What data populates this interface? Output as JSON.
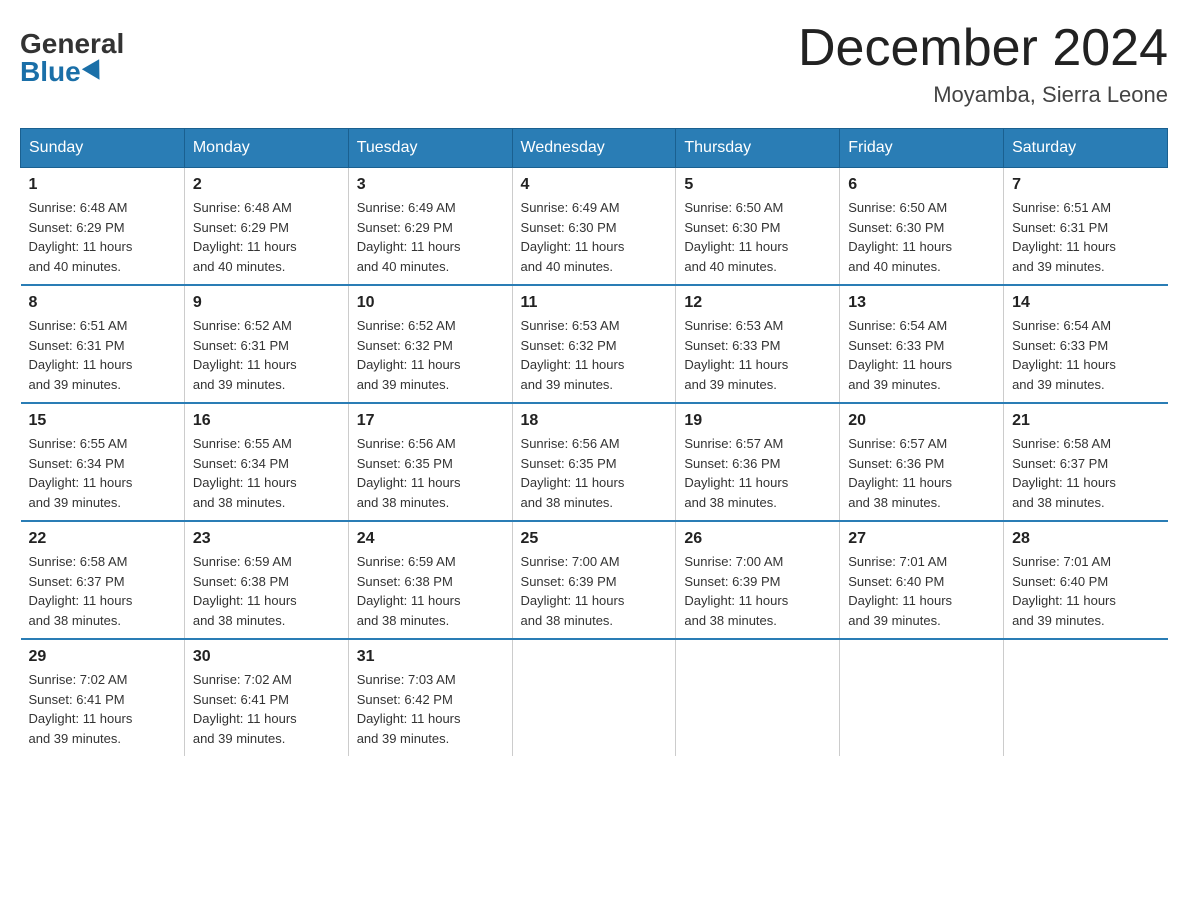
{
  "logo": {
    "general": "General",
    "blue": "Blue"
  },
  "title": "December 2024",
  "location": "Moyamba, Sierra Leone",
  "days_of_week": [
    "Sunday",
    "Monday",
    "Tuesday",
    "Wednesday",
    "Thursday",
    "Friday",
    "Saturday"
  ],
  "weeks": [
    [
      {
        "num": "1",
        "sunrise": "6:48 AM",
        "sunset": "6:29 PM",
        "daylight": "11 hours and 40 minutes."
      },
      {
        "num": "2",
        "sunrise": "6:48 AM",
        "sunset": "6:29 PM",
        "daylight": "11 hours and 40 minutes."
      },
      {
        "num": "3",
        "sunrise": "6:49 AM",
        "sunset": "6:29 PM",
        "daylight": "11 hours and 40 minutes."
      },
      {
        "num": "4",
        "sunrise": "6:49 AM",
        "sunset": "6:30 PM",
        "daylight": "11 hours and 40 minutes."
      },
      {
        "num": "5",
        "sunrise": "6:50 AM",
        "sunset": "6:30 PM",
        "daylight": "11 hours and 40 minutes."
      },
      {
        "num": "6",
        "sunrise": "6:50 AM",
        "sunset": "6:30 PM",
        "daylight": "11 hours and 40 minutes."
      },
      {
        "num": "7",
        "sunrise": "6:51 AM",
        "sunset": "6:31 PM",
        "daylight": "11 hours and 39 minutes."
      }
    ],
    [
      {
        "num": "8",
        "sunrise": "6:51 AM",
        "sunset": "6:31 PM",
        "daylight": "11 hours and 39 minutes."
      },
      {
        "num": "9",
        "sunrise": "6:52 AM",
        "sunset": "6:31 PM",
        "daylight": "11 hours and 39 minutes."
      },
      {
        "num": "10",
        "sunrise": "6:52 AM",
        "sunset": "6:32 PM",
        "daylight": "11 hours and 39 minutes."
      },
      {
        "num": "11",
        "sunrise": "6:53 AM",
        "sunset": "6:32 PM",
        "daylight": "11 hours and 39 minutes."
      },
      {
        "num": "12",
        "sunrise": "6:53 AM",
        "sunset": "6:33 PM",
        "daylight": "11 hours and 39 minutes."
      },
      {
        "num": "13",
        "sunrise": "6:54 AM",
        "sunset": "6:33 PM",
        "daylight": "11 hours and 39 minutes."
      },
      {
        "num": "14",
        "sunrise": "6:54 AM",
        "sunset": "6:33 PM",
        "daylight": "11 hours and 39 minutes."
      }
    ],
    [
      {
        "num": "15",
        "sunrise": "6:55 AM",
        "sunset": "6:34 PM",
        "daylight": "11 hours and 39 minutes."
      },
      {
        "num": "16",
        "sunrise": "6:55 AM",
        "sunset": "6:34 PM",
        "daylight": "11 hours and 38 minutes."
      },
      {
        "num": "17",
        "sunrise": "6:56 AM",
        "sunset": "6:35 PM",
        "daylight": "11 hours and 38 minutes."
      },
      {
        "num": "18",
        "sunrise": "6:56 AM",
        "sunset": "6:35 PM",
        "daylight": "11 hours and 38 minutes."
      },
      {
        "num": "19",
        "sunrise": "6:57 AM",
        "sunset": "6:36 PM",
        "daylight": "11 hours and 38 minutes."
      },
      {
        "num": "20",
        "sunrise": "6:57 AM",
        "sunset": "6:36 PM",
        "daylight": "11 hours and 38 minutes."
      },
      {
        "num": "21",
        "sunrise": "6:58 AM",
        "sunset": "6:37 PM",
        "daylight": "11 hours and 38 minutes."
      }
    ],
    [
      {
        "num": "22",
        "sunrise": "6:58 AM",
        "sunset": "6:37 PM",
        "daylight": "11 hours and 38 minutes."
      },
      {
        "num": "23",
        "sunrise": "6:59 AM",
        "sunset": "6:38 PM",
        "daylight": "11 hours and 38 minutes."
      },
      {
        "num": "24",
        "sunrise": "6:59 AM",
        "sunset": "6:38 PM",
        "daylight": "11 hours and 38 minutes."
      },
      {
        "num": "25",
        "sunrise": "7:00 AM",
        "sunset": "6:39 PM",
        "daylight": "11 hours and 38 minutes."
      },
      {
        "num": "26",
        "sunrise": "7:00 AM",
        "sunset": "6:39 PM",
        "daylight": "11 hours and 38 minutes."
      },
      {
        "num": "27",
        "sunrise": "7:01 AM",
        "sunset": "6:40 PM",
        "daylight": "11 hours and 39 minutes."
      },
      {
        "num": "28",
        "sunrise": "7:01 AM",
        "sunset": "6:40 PM",
        "daylight": "11 hours and 39 minutes."
      }
    ],
    [
      {
        "num": "29",
        "sunrise": "7:02 AM",
        "sunset": "6:41 PM",
        "daylight": "11 hours and 39 minutes."
      },
      {
        "num": "30",
        "sunrise": "7:02 AM",
        "sunset": "6:41 PM",
        "daylight": "11 hours and 39 minutes."
      },
      {
        "num": "31",
        "sunrise": "7:03 AM",
        "sunset": "6:42 PM",
        "daylight": "11 hours and 39 minutes."
      },
      null,
      null,
      null,
      null
    ]
  ],
  "labels": {
    "sunrise": "Sunrise:",
    "sunset": "Sunset:",
    "daylight": "Daylight:"
  }
}
